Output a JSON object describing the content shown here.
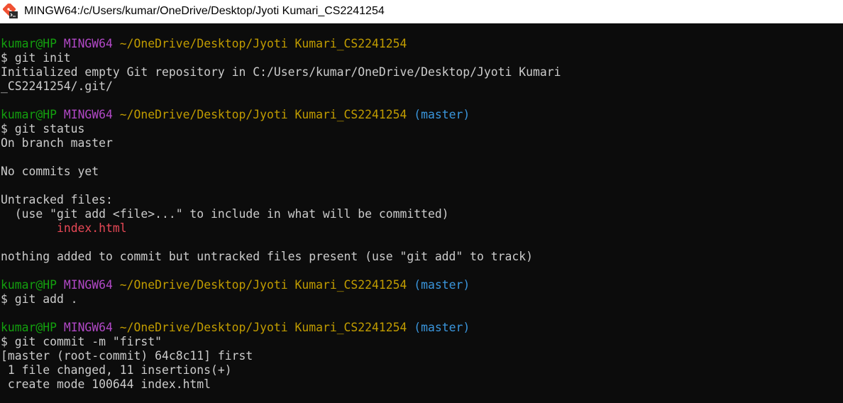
{
  "window": {
    "title": "MINGW64:/c/Users/kumar/OneDrive/Desktop/Jyoti Kumari_CS2241254",
    "icon": "git-bash-icon"
  },
  "terminal": {
    "colors": {
      "background": "#0c0c0c",
      "text": "#cccccc",
      "user_host": "#13a10e",
      "shell": "#b148c6",
      "path": "#c19c00",
      "branch": "#3a96dd",
      "untracked": "#e74856"
    },
    "lines": [
      [
        {
          "t": "kumar@HP",
          "c": "green"
        },
        {
          "t": " "
        },
        {
          "t": "MINGW64",
          "c": "purple"
        },
        {
          "t": " "
        },
        {
          "t": "~/OneDrive/Desktop/Jyoti Kumari_CS2241254",
          "c": "yellow"
        }
      ],
      [
        {
          "t": "$ git init"
        }
      ],
      [
        {
          "t": "Initialized empty Git repository in C:/Users/kumar/OneDrive/Desktop/Jyoti Kumari"
        }
      ],
      [
        {
          "t": "_CS2241254/.git/"
        }
      ],
      [
        {
          "t": ""
        }
      ],
      [
        {
          "t": "kumar@HP",
          "c": "green"
        },
        {
          "t": " "
        },
        {
          "t": "MINGW64",
          "c": "purple"
        },
        {
          "t": " "
        },
        {
          "t": "~/OneDrive/Desktop/Jyoti Kumari_CS2241254",
          "c": "yellow"
        },
        {
          "t": " "
        },
        {
          "t": "(master)",
          "c": "cyan"
        }
      ],
      [
        {
          "t": "$ git status"
        }
      ],
      [
        {
          "t": "On branch master"
        }
      ],
      [
        {
          "t": ""
        }
      ],
      [
        {
          "t": "No commits yet"
        }
      ],
      [
        {
          "t": ""
        }
      ],
      [
        {
          "t": "Untracked files:"
        }
      ],
      [
        {
          "t": "  (use \"git add <file>...\" to include in what will be committed)"
        }
      ],
      [
        {
          "t": "        "
        },
        {
          "t": "index.html",
          "c": "red"
        }
      ],
      [
        {
          "t": ""
        }
      ],
      [
        {
          "t": "nothing added to commit but untracked files present (use \"git add\" to track)"
        }
      ],
      [
        {
          "t": ""
        }
      ],
      [
        {
          "t": "kumar@HP",
          "c": "green"
        },
        {
          "t": " "
        },
        {
          "t": "MINGW64",
          "c": "purple"
        },
        {
          "t": " "
        },
        {
          "t": "~/OneDrive/Desktop/Jyoti Kumari_CS2241254",
          "c": "yellow"
        },
        {
          "t": " "
        },
        {
          "t": "(master)",
          "c": "cyan"
        }
      ],
      [
        {
          "t": "$ git add ."
        }
      ],
      [
        {
          "t": ""
        }
      ],
      [
        {
          "t": "kumar@HP",
          "c": "green"
        },
        {
          "t": " "
        },
        {
          "t": "MINGW64",
          "c": "purple"
        },
        {
          "t": " "
        },
        {
          "t": "~/OneDrive/Desktop/Jyoti Kumari_CS2241254",
          "c": "yellow"
        },
        {
          "t": " "
        },
        {
          "t": "(master)",
          "c": "cyan"
        }
      ],
      [
        {
          "t": "$ git commit -m \"first\""
        }
      ],
      [
        {
          "t": "[master (root-commit) 64c8c11] first"
        }
      ],
      [
        {
          "t": " 1 file changed, 11 insertions(+)"
        }
      ],
      [
        {
          "t": " create mode 100644 index.html"
        }
      ]
    ]
  }
}
